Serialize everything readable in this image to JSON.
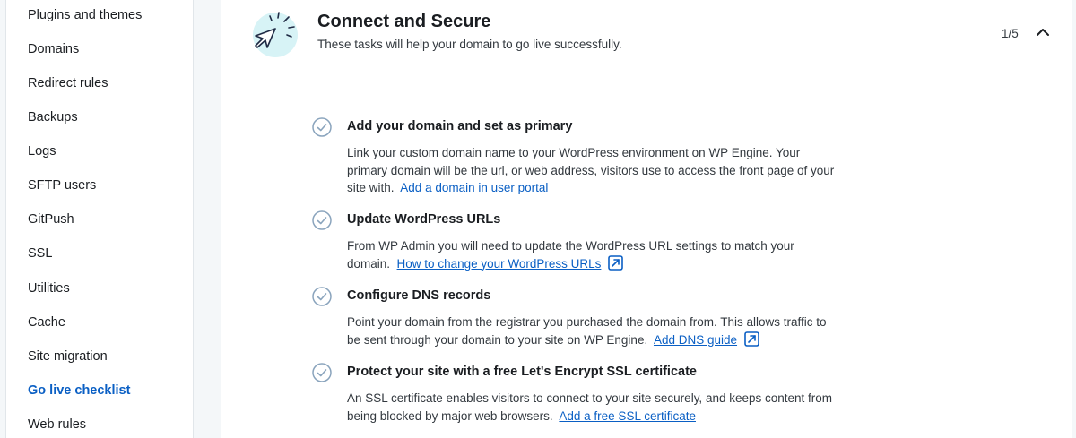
{
  "sidebar": {
    "items": [
      {
        "label": "Plugins and themes"
      },
      {
        "label": "Domains"
      },
      {
        "label": "Redirect rules"
      },
      {
        "label": "Backups"
      },
      {
        "label": "Logs"
      },
      {
        "label": "SFTP users"
      },
      {
        "label": "GitPush"
      },
      {
        "label": "SSL"
      },
      {
        "label": "Utilities"
      },
      {
        "label": "Cache"
      },
      {
        "label": "Site migration"
      },
      {
        "label": "Go live checklist",
        "active": true
      },
      {
        "label": "Web rules"
      }
    ]
  },
  "section": {
    "title": "Connect and Secure",
    "subtitle": "These tasks will help your domain to go live successfully.",
    "progress": "1/5",
    "icon": "cursor-click-icon",
    "collapse_icon": "chevron-up-icon"
  },
  "tasks": [
    {
      "title": "Add your domain and set as primary",
      "text": "Link your custom domain name to your WordPress environment on WP Engine. Your primary domain will be the url, or web address, visitors use to access the front page of your site with.",
      "link": "Add a domain in user portal",
      "external": false
    },
    {
      "title": "Update WordPress URLs",
      "text": "From WP Admin you will need to update the WordPress URL settings to match your domain.",
      "link": "How to change your WordPress URLs",
      "external": true
    },
    {
      "title": "Configure DNS records",
      "text": "Point your domain from the registrar you purchased the domain from. This allows traffic to be sent through your domain to your site on WP Engine.",
      "link": "Add DNS guide",
      "external": true
    },
    {
      "title": "Protect your site with a free Let's Encrypt SSL certificate",
      "text": "An SSL certificate enables visitors to connect to your site securely, and keeps content from being blocked by major web browsers.",
      "link": "Add a free SSL certificate",
      "external": false
    }
  ],
  "colors": {
    "accent": "#0a5fc4",
    "check": "#8aa4bd",
    "icon_bg": "#d7f3f6"
  }
}
